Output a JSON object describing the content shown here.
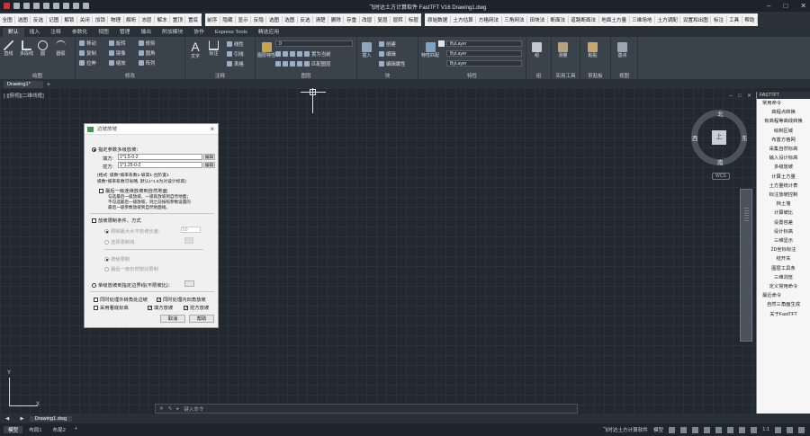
{
  "title_bar": {
    "text": "飞时达土方计算软件 FastTFT V16    Drawing1.dwg"
  },
  "custom_menu": {
    "group1": [
      "全图",
      "选图",
      "反选",
      "记图",
      "解锁",
      "关闭",
      "加锁",
      "物理",
      "解析",
      "冻层",
      "解冻",
      "置顶",
      "置底"
    ],
    "group2": [
      "前序",
      "隐藏",
      "显示",
      "反隐",
      "选图",
      "选图",
      "反选",
      "清楚",
      "删除",
      "存重",
      "改层",
      "复层",
      "层转",
      "标层"
    ],
    "group3": [
      "原始数据",
      "土方估算",
      "方格网法",
      "三角网法",
      "田块法",
      "断面法",
      "道路断面法",
      "地面土方量",
      "三维场地",
      "土方调配",
      "设置和出图",
      "标注",
      "工具",
      "帮助"
    ]
  },
  "ribbon_tabs": [
    "默认",
    "插入",
    "注释",
    "参数化",
    "视图",
    "管理",
    "输出",
    "附加模块",
    "协作",
    "Express Tools",
    "精选应用"
  ],
  "ribbon": {
    "draw": {
      "label": "绘图",
      "tools": [
        "直线",
        "多段线",
        "圆",
        "圆弧"
      ]
    },
    "modify": {
      "label": "修改",
      "rows": [
        [
          "移动",
          "旋转",
          "修剪"
        ],
        [
          "复制",
          "镜像",
          "圆角"
        ],
        [
          "拉伸",
          "缩放",
          "阵列"
        ]
      ]
    },
    "annotation": {
      "label": "注释",
      "tools": [
        "文字",
        "标注"
      ],
      "rows": [
        "线性",
        "引线",
        "表格"
      ]
    },
    "layers": {
      "label": "图层",
      "layer_value": "0",
      "rows": [
        "置为当前",
        "匹配图层"
      ],
      "tool": "图层特性"
    },
    "block": {
      "label": "块",
      "tool": "插入",
      "rows": [
        "创建",
        "编辑",
        "编辑属性"
      ]
    },
    "properties": {
      "label": "特性",
      "tool": "特性匹配",
      "values": [
        "ByLayer",
        "ByLayer",
        "ByLayer"
      ]
    },
    "groups": {
      "label": "组",
      "tool": "组"
    },
    "utilities": {
      "label": "实用工具",
      "tools": [
        "测量"
      ]
    },
    "clipboard": {
      "label": "剪贴板",
      "tools": [
        "粘贴"
      ]
    },
    "view": {
      "label": "视图",
      "tools": [
        "基点"
      ]
    }
  },
  "file_tab": {
    "label": "Drawing1*"
  },
  "viewport_label": "[-][俯视][二维线框]",
  "viewcube": {
    "top": "上",
    "north": "北",
    "south": "南",
    "east": "东",
    "west": "西",
    "wcs": "WCS"
  },
  "palette": {
    "header": "FASTTFT",
    "items": [
      {
        "t": "常用命令",
        "lab": true
      },
      {
        "t": "高程点转换"
      },
      {
        "t": "有高程等高线转换"
      },
      {
        "t": "绘制区域"
      },
      {
        "t": "布置方格网"
      },
      {
        "t": "采集自然标高"
      },
      {
        "t": "输入设计标高"
      },
      {
        "t": "多级放坡"
      },
      {
        "t": "计算土方量"
      },
      {
        "t": "土方量统计表"
      },
      {
        "t": "标注放坡控制"
      },
      {
        "t": "挡土墙"
      },
      {
        "t": "计算坡比"
      },
      {
        "t": "设置容差"
      },
      {
        "t": "设计标高"
      },
      {
        "t": "三维显示"
      },
      {
        "t": "2D坐标标注"
      },
      {
        "t": "结开关"
      },
      {
        "t": "图层工具条"
      },
      {
        "t": "三维浏览"
      },
      {
        "t": "定义常用命令"
      },
      {
        "t": "最近命令",
        "lab": true
      },
      {
        "t": "自然三角面生成"
      },
      {
        "t": "关于FastTFT"
      }
    ]
  },
  "cmdline": {
    "placeholder": "键入命令"
  },
  "layout_tabs": [
    "模型",
    "布局1",
    "布局2"
  ],
  "bottom_file": "Drawing1.dwg",
  "status": {
    "app": "飞时达土方计算软件",
    "model": "模型",
    "scale": "1:1"
  },
  "dialog": {
    "title": "边坡放坡",
    "opt1": "指定参数多级放坡：",
    "fill_label": "填方:",
    "fill_value": "1*1.5-0-2",
    "fill_btn": "编辑",
    "cut_label": "挖方:",
    "cut_value": "1*1.25-0-2",
    "cut_btn": "编辑",
    "fmt1": "(格式: 级数*坡率系数1-坡高1-台阶宽1",
    "fmt2": " 级数*坡率系数可省略, 默认1*1.5为对设计标高)",
    "chk_last": "最后一级连续放坡到自然地面",
    "note1": "勾选最后一级放坡，一级就放坡到自然地面；",
    "note2": "不勾选最后一级放坡，则之前按照参数设置的",
    "note3": "最后一级参数放坡到自然地面线。",
    "chk_limit": "放坡限制条件、方式",
    "r_maxlen": "限制最大水平放坡长度:",
    "maxlen_val": "50",
    "r_selline": "选择限制线",
    "r_level": "按级限制",
    "r_lastratio": "最后一级仍然按比限制",
    "opt2": "单级放坡到指定边界线(不限坡比)：",
    "chk_corner": "同时处理外转角处边坡",
    "chk_inner": "同时处理内凹角放坡",
    "chk_nat": "采用看底标高",
    "chk_fill": "填方放坡",
    "chk_cut": "挖方放坡",
    "cancel": "取消",
    "help": "帮助"
  }
}
